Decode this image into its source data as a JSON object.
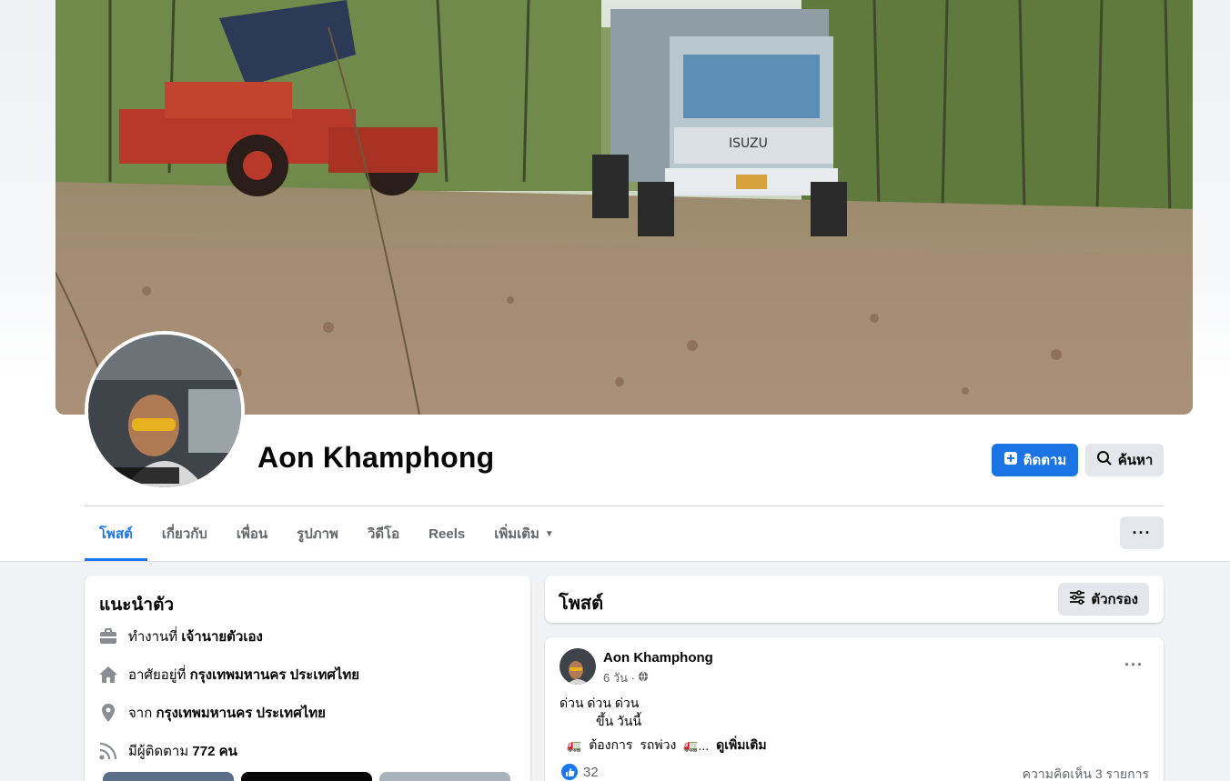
{
  "profile": {
    "name": "Aon Khamphong",
    "follow_label": "ติดตาม",
    "search_label": "ค้นหา"
  },
  "tabs": [
    {
      "label": "โพสต์",
      "active": true
    },
    {
      "label": "เกี่ยวกับ"
    },
    {
      "label": "เพื่อน"
    },
    {
      "label": "รูปภาพ"
    },
    {
      "label": "วิดีโอ"
    },
    {
      "label": "Reels"
    },
    {
      "label": "เพิ่มเติม"
    }
  ],
  "more_options": "···",
  "intro": {
    "title": "แนะนำตัว",
    "work_prefix": "ทำงานที่",
    "work": "เจ้านายตัวเอง",
    "lives_prefix": "อาศัยอยู่ที่",
    "lives": "กรุงเทพมหานคร ประเทศไทย",
    "from_prefix": "จาก",
    "from": "กรุงเทพมหานคร ประเทศไทย",
    "followers_prefix": "มีผู้ติดตาม",
    "followers": "772 คน"
  },
  "posts_section": {
    "title": "โพสต์",
    "filter_label": "ตัวกรอง"
  },
  "post": {
    "author": "Aon Khamphong",
    "time": "6 วัน ·",
    "line1": "ด่วน ด่วน ด่วน",
    "line2": "ขึ้น วันนี้",
    "line3_a": "ต้องการ",
    "line3_b": "รถพ่วง",
    "line3_c": "...",
    "see_more": "ดูเพิ่มเติม",
    "likes": "32",
    "comments": "ความคิดเห็น 3 รายการ"
  },
  "colors": {
    "accent": "#1877f2",
    "follow_button": "#1b74e4",
    "page_bg": "#f0f2f5"
  },
  "icons": [
    "plus-icon",
    "search-icon",
    "briefcase-icon",
    "home-icon",
    "location-pin-icon",
    "rss-icon",
    "filter-icon",
    "globe-icon",
    "like-icon",
    "truck-icon"
  ]
}
